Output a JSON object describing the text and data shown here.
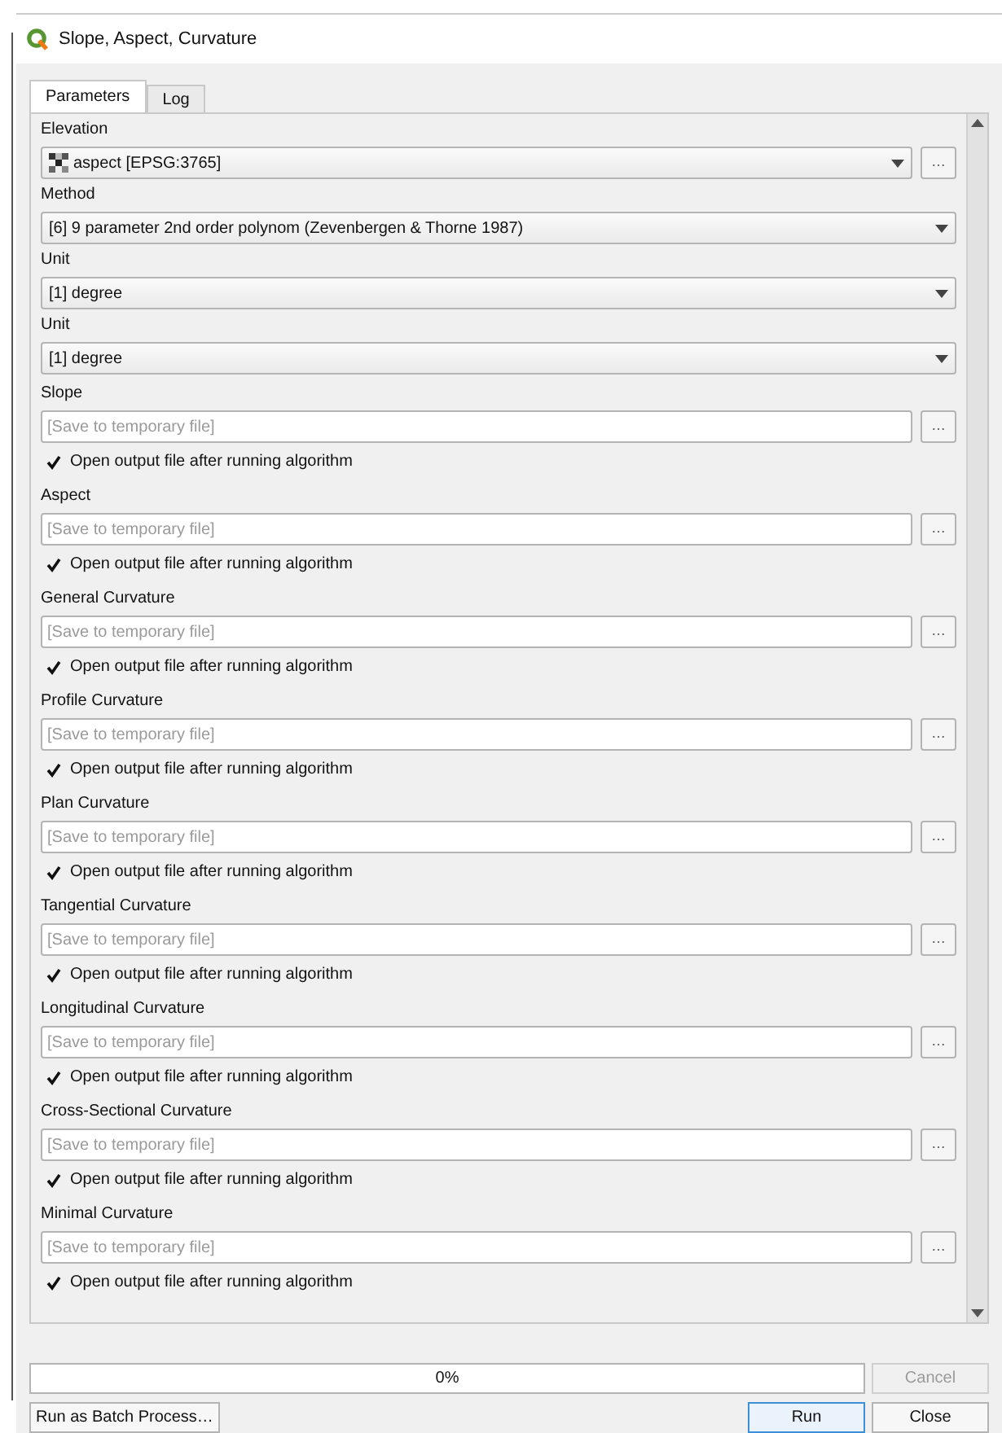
{
  "window": {
    "title": "Slope, Aspect, Curvature"
  },
  "tabs": [
    {
      "label": "Parameters",
      "selected": true
    },
    {
      "label": "Log",
      "selected": false
    }
  ],
  "inputs": [
    {
      "kind": "layer",
      "label": "Elevation",
      "value": "aspect [EPSG:3765]",
      "browse": "…"
    },
    {
      "kind": "combo",
      "label": "Method",
      "value": "[6] 9 parameter 2nd order polynom (Zevenbergen & Thorne 1987)"
    },
    {
      "kind": "combo",
      "label": "Unit",
      "value": "[1] degree"
    },
    {
      "kind": "combo",
      "label": "Unit",
      "value": "[1] degree"
    }
  ],
  "outputs": [
    {
      "label": "Slope",
      "placeholder": "[Save to temporary file]",
      "browse": "…",
      "open_label": "Open output file after running algorithm",
      "checked": true
    },
    {
      "label": "Aspect",
      "placeholder": "[Save to temporary file]",
      "browse": "…",
      "open_label": "Open output file after running algorithm",
      "checked": true
    },
    {
      "label": "General Curvature",
      "placeholder": "[Save to temporary file]",
      "browse": "…",
      "open_label": "Open output file after running algorithm",
      "checked": true
    },
    {
      "label": "Profile Curvature",
      "placeholder": "[Save to temporary file]",
      "browse": "…",
      "open_label": "Open output file after running algorithm",
      "checked": true
    },
    {
      "label": "Plan Curvature",
      "placeholder": "[Save to temporary file]",
      "browse": "…",
      "open_label": "Open output file after running algorithm",
      "checked": true
    },
    {
      "label": "Tangential Curvature",
      "placeholder": "[Save to temporary file]",
      "browse": "…",
      "open_label": "Open output file after running algorithm",
      "checked": true
    },
    {
      "label": "Longitudinal Curvature",
      "placeholder": "[Save to temporary file]",
      "browse": "…",
      "open_label": "Open output file after running algorithm",
      "checked": true
    },
    {
      "label": "Cross-Sectional Curvature",
      "placeholder": "[Save to temporary file]",
      "browse": "…",
      "open_label": "Open output file after running algorithm",
      "checked": true
    },
    {
      "label": "Minimal Curvature",
      "placeholder": "[Save to temporary file]",
      "browse": "…",
      "open_label": "Open output file after running algorithm",
      "checked": true
    }
  ],
  "progress": {
    "level": 0,
    "text": "0%"
  },
  "cancel": {
    "label": "Cancel",
    "disabled": true
  },
  "batch_button": "Run as Batch Process…",
  "buttons": [
    "Run",
    "Close"
  ]
}
